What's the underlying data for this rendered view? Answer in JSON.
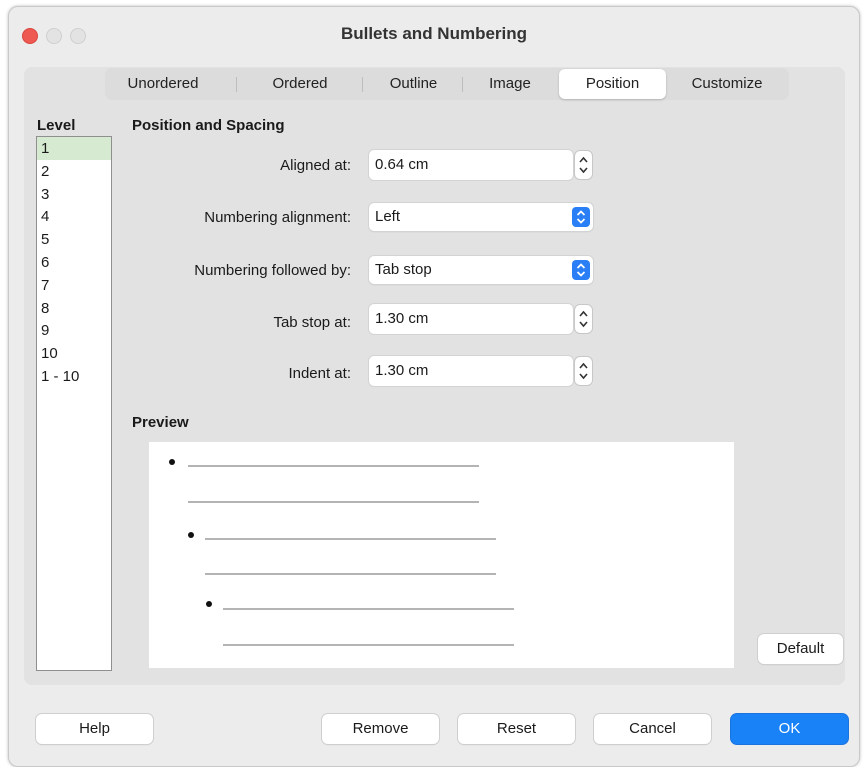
{
  "window": {
    "title": "Bullets and Numbering"
  },
  "tabs": [
    {
      "label": "Unordered",
      "active": false
    },
    {
      "label": "Ordered",
      "active": false
    },
    {
      "label": "Outline",
      "active": false
    },
    {
      "label": "Image",
      "active": false
    },
    {
      "label": "Position",
      "active": true
    },
    {
      "label": "Customize",
      "active": false
    }
  ],
  "level": {
    "label": "Level",
    "items": [
      "1",
      "2",
      "3",
      "4",
      "5",
      "6",
      "7",
      "8",
      "9",
      "10",
      "1 - 10"
    ],
    "selected": "1"
  },
  "position": {
    "title": "Position and Spacing",
    "aligned_at": {
      "label": "Aligned at:",
      "value": "0.64 cm"
    },
    "numbering_alignment": {
      "label": "Numbering alignment:",
      "value": "Left"
    },
    "numbering_followed_by": {
      "label": "Numbering followed by:",
      "value": "Tab stop"
    },
    "tab_stop_at": {
      "label": "Tab stop at:",
      "value": "1.30 cm"
    },
    "indent_at": {
      "label": "Indent at:",
      "value": "1.30 cm"
    }
  },
  "preview": {
    "title": "Preview"
  },
  "buttons": {
    "default": "Default",
    "help": "Help",
    "remove": "Remove",
    "reset": "Reset",
    "cancel": "Cancel",
    "ok": "OK"
  },
  "colors": {
    "accent": "#1a82f7",
    "selected_row": "#d5ead0",
    "close_button": "#ee5a52"
  }
}
